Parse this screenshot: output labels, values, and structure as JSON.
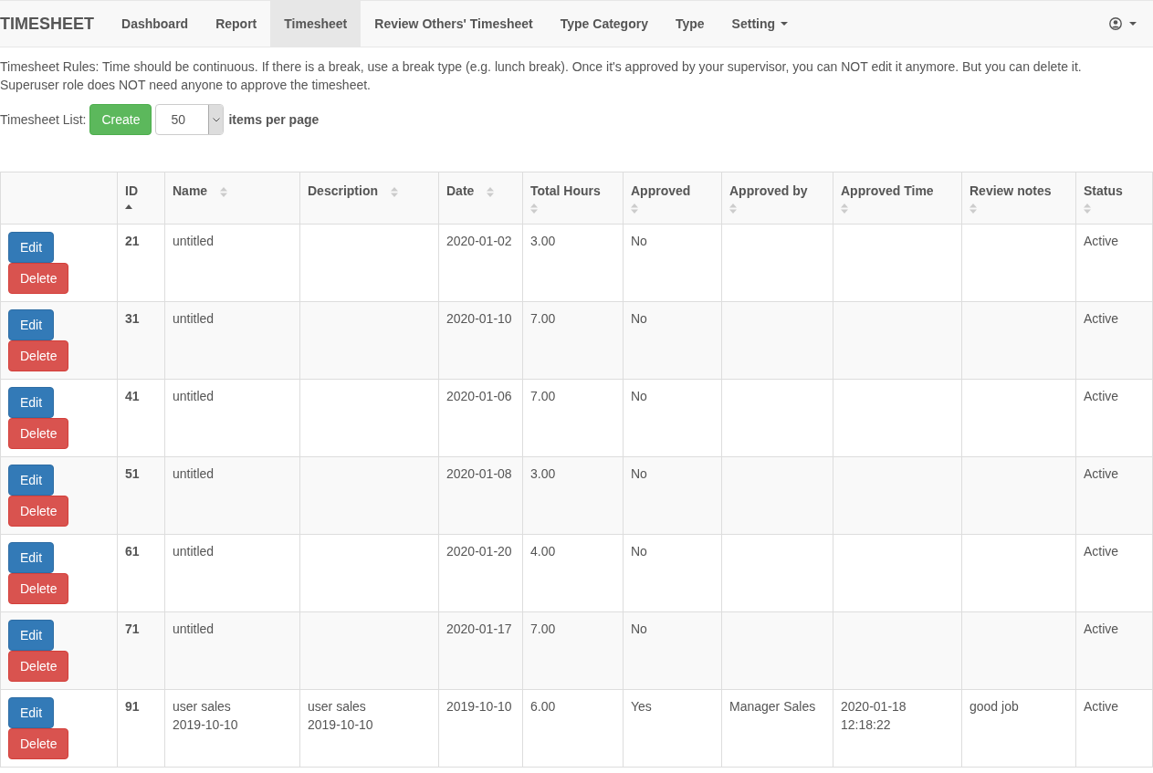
{
  "navbar": {
    "brand": "TIMESHEET",
    "items": [
      {
        "label": "Dashboard",
        "selected": false,
        "dropdown": false
      },
      {
        "label": "Report",
        "selected": false,
        "dropdown": false
      },
      {
        "label": "Timesheet",
        "selected": true,
        "dropdown": false
      },
      {
        "label": "Review Others' Timesheet",
        "selected": false,
        "dropdown": false
      },
      {
        "label": "Type Category",
        "selected": false,
        "dropdown": false
      },
      {
        "label": "Type",
        "selected": false,
        "dropdown": false
      },
      {
        "label": "Setting",
        "selected": false,
        "dropdown": true
      }
    ]
  },
  "rules": "Timesheet Rules: Time should be continuous. If there is a break, use a break type (e.g. lunch break). Once it's approved by your supervisor, you can NOT edit it anymore. But you can delete it. Superuser role does NOT need anyone to approve the timesheet.",
  "toolbar": {
    "label": "Timesheet List:",
    "create_button": "Create",
    "page_size": "50",
    "page_size_suffix": "items per page"
  },
  "table": {
    "columns": [
      {
        "label": "ID",
        "sorted": true
      },
      {
        "label": "Name",
        "sorted": false
      },
      {
        "label": "Description",
        "sorted": false
      },
      {
        "label": "Date",
        "sorted": false
      },
      {
        "label": "Total Hours",
        "sorted": false
      },
      {
        "label": "Approved",
        "sorted": false
      },
      {
        "label": "Approved by",
        "sorted": false
      },
      {
        "label": "Approved Time",
        "sorted": false
      },
      {
        "label": "Review notes",
        "sorted": false
      },
      {
        "label": "Status",
        "sorted": false
      }
    ],
    "rows": [
      {
        "edit": "Edit",
        "delete": "Delete",
        "id": "21",
        "name": "untitled",
        "date": "2020-01-02",
        "total_hours": "3.00",
        "approved": "No",
        "status": "Active"
      },
      {
        "edit": "Edit",
        "delete": "Delete",
        "id": "31",
        "name": "untitled",
        "date": "2020-01-10",
        "total_hours": "7.00",
        "approved": "No",
        "status": "Active"
      },
      {
        "edit": "Edit",
        "delete": "Delete",
        "id": "41",
        "name": "untitled",
        "date": "2020-01-06",
        "total_hours": "7.00",
        "approved": "No",
        "status": "Active"
      },
      {
        "edit": "Edit",
        "delete": "Delete",
        "id": "51",
        "name": "untitled",
        "date": "2020-01-08",
        "total_hours": "3.00",
        "approved": "No",
        "status": "Active"
      },
      {
        "edit": "Edit",
        "delete": "Delete",
        "id": "61",
        "name": "untitled",
        "date": "2020-01-20",
        "total_hours": "4.00",
        "approved": "No",
        "status": "Active"
      },
      {
        "edit": "Edit",
        "delete": "Delete",
        "id": "71",
        "name": "untitled",
        "date": "2020-01-17",
        "total_hours": "7.00",
        "approved": "No",
        "status": "Active"
      },
      {
        "edit": "Edit",
        "delete": "Delete",
        "id": "91",
        "name": "user sales 2019-10-10",
        "description": "user sales 2019-10-10",
        "date": "2019-10-10",
        "total_hours": "6.00",
        "approved": "Yes",
        "approved_by": "Manager Sales",
        "approved_time": "2020-01-18 12:18:22",
        "review_notes": "good job",
        "status": "Active"
      }
    ]
  }
}
